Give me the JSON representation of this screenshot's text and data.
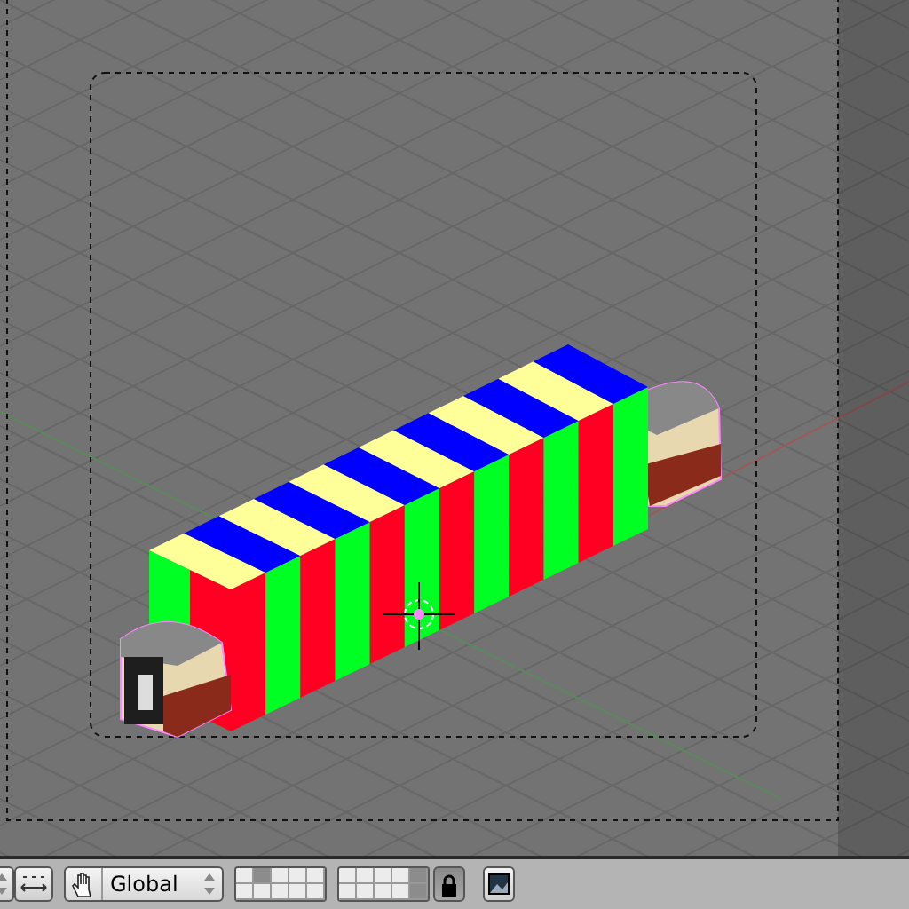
{
  "header": {
    "orientation": {
      "label": "Global"
    },
    "layers": [
      {
        "selected": false
      },
      {
        "selected": true
      },
      {
        "selected": false
      },
      {
        "selected": false
      },
      {
        "selected": false
      },
      {
        "selected": false
      },
      {
        "selected": false
      },
      {
        "selected": false
      },
      {
        "selected": false
      },
      {
        "selected": true
      },
      {
        "selected": false
      },
      {
        "selected": false
      },
      {
        "selected": false
      },
      {
        "selected": false
      },
      {
        "selected": false
      },
      {
        "selected": false
      },
      {
        "selected": false
      },
      {
        "selected": false
      },
      {
        "selected": false
      },
      {
        "selected": true
      }
    ],
    "lock": {
      "on": true
    }
  }
}
